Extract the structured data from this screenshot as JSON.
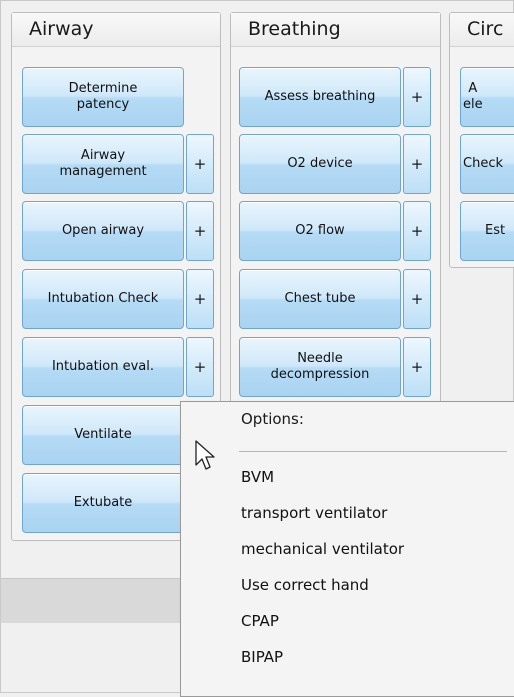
{
  "panels": {
    "airway": {
      "title": "Airway",
      "buttons": [
        {
          "label": "Determine\npatency",
          "has_plus": false
        },
        {
          "label": "Airway\nmanagement",
          "has_plus": true
        },
        {
          "label": "Open airway",
          "has_plus": true
        },
        {
          "label": "Intubation Check",
          "has_plus": true
        },
        {
          "label": "Intubation eval.",
          "has_plus": true
        },
        {
          "label": "Ventilate",
          "has_plus": false
        },
        {
          "label": "Extubate",
          "has_plus": false
        }
      ]
    },
    "breathing": {
      "title": "Breathing",
      "buttons": [
        {
          "label": "Assess breathing",
          "has_plus": true
        },
        {
          "label": "O2 device",
          "has_plus": true
        },
        {
          "label": "O2 flow",
          "has_plus": true
        },
        {
          "label": "Chest tube",
          "has_plus": true
        },
        {
          "label": "Needle\ndecompression",
          "has_plus": true
        }
      ]
    },
    "circulation": {
      "title": "Circ",
      "buttons": [
        {
          "label": "A\nele"
        },
        {
          "label": "Check"
        },
        {
          "label": "Est"
        }
      ]
    }
  },
  "plus_label": "+",
  "dropdown": {
    "header": "Options:",
    "items": [
      "BVM",
      "transport ventilator",
      "mechanical ventilator",
      "Use correct hand",
      "CPAP",
      "BIPAP"
    ]
  }
}
